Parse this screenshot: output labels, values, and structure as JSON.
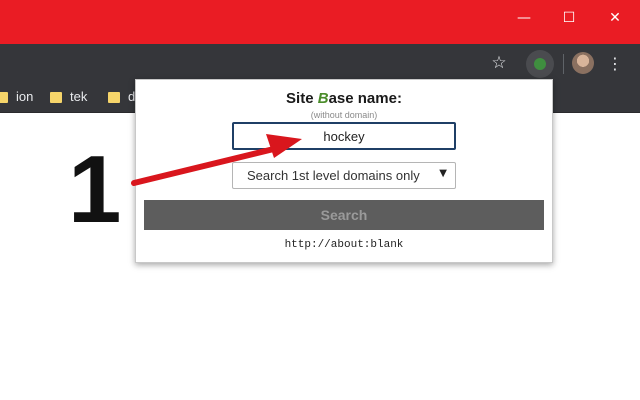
{
  "window_controls": {
    "minimize": "—",
    "maximize": "☐",
    "close": "✕"
  },
  "toolbar": {
    "star_icon": "☆",
    "menu_icon": "⋮"
  },
  "bookmarks": [
    {
      "label": "ion"
    },
    {
      "label": "tek"
    },
    {
      "label": "d"
    }
  ],
  "popup": {
    "title_pre": "Site ",
    "title_b": "B",
    "title_post": "ase name:",
    "subtitle": "(without domain)",
    "input_value": "hockey",
    "select_value": "Search 1st level domains only",
    "select_caret": "▼",
    "search_label": "Search",
    "url": "http://about:blank"
  },
  "annotation": {
    "step_number": "1"
  },
  "colors": {
    "titlebar": "#ea1c24",
    "toolbar": "#35363a",
    "arrow": "#d9161d",
    "search_button": "#5d5d5d"
  },
  "icons": [
    "minimize-icon",
    "maximize-icon",
    "close-icon",
    "star-icon",
    "extension-icon",
    "avatar-icon",
    "menu-icon",
    "folder-icon",
    "arrow-annotation"
  ]
}
